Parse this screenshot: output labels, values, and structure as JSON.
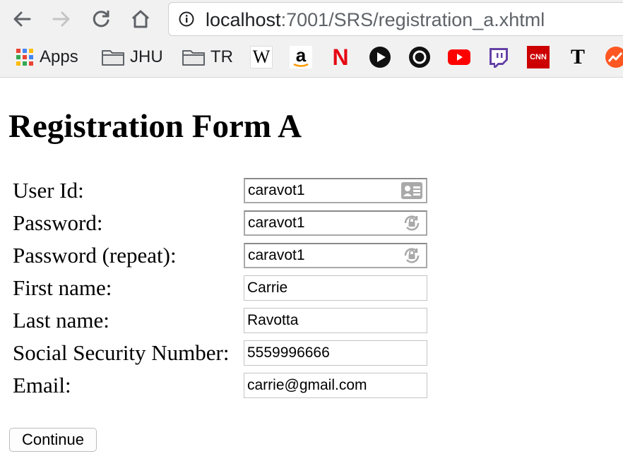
{
  "browser": {
    "url_host": "localhost",
    "url_path": ":7001/SRS/registration_a.xhtml",
    "bookmarks": [
      {
        "label": "Apps",
        "icon": "apps-grid-icon"
      },
      {
        "label": "JHU",
        "icon": "folder-icon"
      },
      {
        "label": "TR",
        "icon": "folder-icon"
      },
      {
        "label": "",
        "icon": "wikipedia-icon",
        "glyph": "W"
      },
      {
        "label": "",
        "icon": "amazon-icon",
        "glyph": "a"
      },
      {
        "label": "",
        "icon": "netflix-icon",
        "glyph": "N"
      },
      {
        "label": "",
        "icon": "play-icon"
      },
      {
        "label": "",
        "icon": "record-icon"
      },
      {
        "label": "",
        "icon": "youtube-icon"
      },
      {
        "label": "",
        "icon": "twitch-icon"
      },
      {
        "label": "",
        "icon": "cnn-icon",
        "glyph": "CNN"
      },
      {
        "label": "",
        "icon": "nytimes-icon",
        "glyph": "T"
      },
      {
        "label": "",
        "icon": "trending-icon"
      }
    ],
    "colors": {
      "netflix": "#e50914",
      "youtube": "#ff0000",
      "twitch": "#6441a5",
      "cnn": "#cc0000",
      "trend": "#ff5722"
    }
  },
  "page": {
    "title": "Registration Form A",
    "fields": [
      {
        "label": "User Id:",
        "value": "caravot1",
        "type": "text",
        "icon": "contact-card-icon"
      },
      {
        "label": "Password:",
        "value": "caravot1",
        "type": "text",
        "icon": "password-lock-icon"
      },
      {
        "label": "Password (repeat):",
        "value": "caravot1",
        "type": "text",
        "icon": "password-lock-icon"
      },
      {
        "label": "First name:",
        "value": "Carrie",
        "type": "text"
      },
      {
        "label": "Last name:",
        "value": "Ravotta",
        "type": "text"
      },
      {
        "label": "Social Security Number:",
        "value": "5559996666",
        "type": "text"
      },
      {
        "label": "Email:",
        "value": "carrie@gmail.com",
        "type": "text"
      }
    ],
    "continue_label": "Continue"
  }
}
